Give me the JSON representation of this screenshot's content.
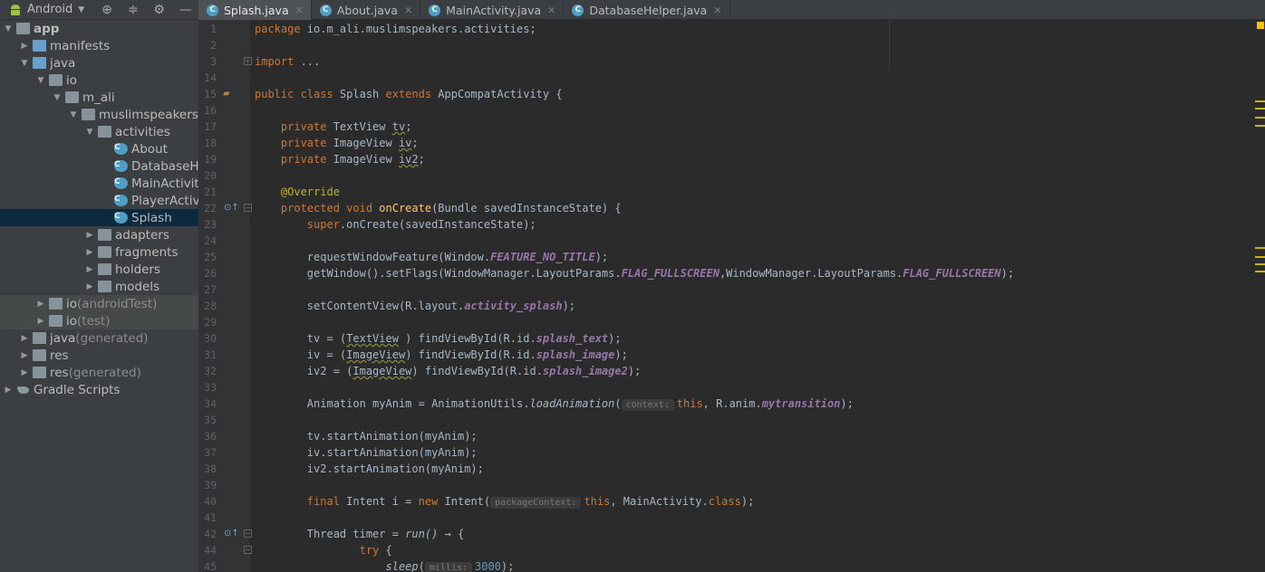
{
  "sidebar": {
    "view_mode": "Android",
    "toolbar_icons": [
      "target-icon",
      "collapse-icon",
      "gear-icon",
      "minimize-icon"
    ],
    "tree": [
      {
        "label": "app",
        "indent": 0,
        "arrow": "down",
        "icon": "module-folder-icon",
        "bold": true
      },
      {
        "label": "manifests",
        "indent": 1,
        "arrow": "right",
        "icon": "folder-icon"
      },
      {
        "label": "java",
        "indent": 1,
        "arrow": "down",
        "icon": "folder-icon"
      },
      {
        "label": "io",
        "indent": 2,
        "arrow": "down",
        "icon": "package-icon"
      },
      {
        "label": "m_ali",
        "indent": 3,
        "arrow": "down",
        "icon": "package-icon"
      },
      {
        "label": "muslimspeakers",
        "indent": 4,
        "arrow": "down",
        "icon": "package-icon"
      },
      {
        "label": "activities",
        "indent": 5,
        "arrow": "down",
        "icon": "package-icon"
      },
      {
        "label": "About",
        "indent": 6,
        "arrow": "",
        "icon": "class-icon"
      },
      {
        "label": "DatabaseHe",
        "indent": 6,
        "arrow": "",
        "icon": "class-icon"
      },
      {
        "label": "MainActivit",
        "indent": 6,
        "arrow": "",
        "icon": "class-icon"
      },
      {
        "label": "PlayerActivi",
        "indent": 6,
        "arrow": "",
        "icon": "class-icon"
      },
      {
        "label": "Splash",
        "indent": 6,
        "arrow": "",
        "icon": "class-icon",
        "selected": true
      },
      {
        "label": "adapters",
        "indent": 5,
        "arrow": "right",
        "icon": "package-icon"
      },
      {
        "label": "fragments",
        "indent": 5,
        "arrow": "right",
        "icon": "package-icon"
      },
      {
        "label": "holders",
        "indent": 5,
        "arrow": "right",
        "icon": "package-icon"
      },
      {
        "label": "models",
        "indent": 5,
        "arrow": "right",
        "icon": "package-icon"
      },
      {
        "label": "io",
        "sub": "(androidTest)",
        "indent": 2,
        "arrow": "right",
        "icon": "package-icon",
        "dim": true
      },
      {
        "label": "io",
        "sub": "(test)",
        "indent": 2,
        "arrow": "right",
        "icon": "package-icon",
        "dim": true
      },
      {
        "label": "java",
        "sub": "(generated)",
        "indent": 1,
        "arrow": "right",
        "icon": "generated-folder-icon"
      },
      {
        "label": "res",
        "indent": 1,
        "arrow": "right",
        "icon": "res-folder-icon"
      },
      {
        "label": "res",
        "sub": "(generated)",
        "indent": 1,
        "arrow": "right",
        "icon": "res-folder-icon"
      },
      {
        "label": "Gradle Scripts",
        "indent": 0,
        "arrow": "right",
        "icon": "gradle-icon"
      }
    ]
  },
  "tabs": [
    {
      "label": "Splash.java",
      "active": true
    },
    {
      "label": "About.java"
    },
    {
      "label": "MainActivity.java"
    },
    {
      "label": "DatabaseHelper.java"
    }
  ],
  "editor": {
    "lines": [
      {
        "n": "1",
        "tokens": [
          [
            "kw",
            "package "
          ],
          [
            "",
            "io.m_ali.muslimspeakers.activities;"
          ]
        ]
      },
      {
        "n": "2",
        "tokens": []
      },
      {
        "n": "3",
        "fold": "+",
        "tokens": [
          [
            "kw",
            "import "
          ],
          [
            "",
            "..."
          ]
        ]
      },
      {
        "n": "14",
        "tokens": []
      },
      {
        "n": "15",
        "gicon": "android-icon",
        "tokens": [
          [
            "kw",
            "public class "
          ],
          [
            "",
            "Splash "
          ],
          [
            "kw",
            "extends "
          ],
          [
            "",
            "AppCompatActivity {"
          ]
        ]
      },
      {
        "n": "16",
        "tokens": []
      },
      {
        "n": "17",
        "tokens": [
          [
            "",
            "    "
          ],
          [
            "kw",
            "private "
          ],
          [
            "",
            "TextView "
          ],
          [
            "ul",
            "tv"
          ],
          [
            "",
            ";"
          ]
        ]
      },
      {
        "n": "18",
        "tokens": [
          [
            "",
            "    "
          ],
          [
            "kw",
            "private "
          ],
          [
            "",
            "ImageView "
          ],
          [
            "ul",
            "iv"
          ],
          [
            "",
            ";"
          ]
        ]
      },
      {
        "n": "19",
        "tokens": [
          [
            "",
            "    "
          ],
          [
            "kw",
            "private "
          ],
          [
            "",
            "ImageView "
          ],
          [
            "ul",
            "iv2"
          ],
          [
            "",
            ";"
          ]
        ]
      },
      {
        "n": "20",
        "tokens": []
      },
      {
        "n": "21",
        "tokens": [
          [
            "",
            "    "
          ],
          [
            "an",
            "@Override"
          ]
        ]
      },
      {
        "n": "22",
        "gicon": "override-icon",
        "fold": "-",
        "tokens": [
          [
            "",
            "    "
          ],
          [
            "kw",
            "protected void "
          ],
          [
            "fn",
            "onCreate"
          ],
          [
            "",
            "(Bundle savedInstanceState) {"
          ]
        ]
      },
      {
        "n": "23",
        "tokens": [
          [
            "",
            "        "
          ],
          [
            "kw",
            "super"
          ],
          [
            "",
            ".onCreate(savedInstanceState);"
          ]
        ]
      },
      {
        "n": "24",
        "tokens": []
      },
      {
        "n": "25",
        "tokens": [
          [
            "",
            "        requestWindowFeature(Window."
          ],
          [
            "st",
            "FEATURE_NO_TITLE"
          ],
          [
            "",
            ");"
          ]
        ]
      },
      {
        "n": "26",
        "tokens": [
          [
            "",
            "        getWindow().setFlags(WindowManager.LayoutParams."
          ],
          [
            "st",
            "FLAG_FULLSCREEN"
          ],
          [
            "",
            ",WindowManager.LayoutParams."
          ],
          [
            "st",
            "FLAG_FULLSCREEN"
          ],
          [
            "",
            ");"
          ]
        ]
      },
      {
        "n": "27",
        "tokens": []
      },
      {
        "n": "28",
        "tokens": [
          [
            "",
            "        setContentView(R.layout."
          ],
          [
            "st",
            "activity_splash"
          ],
          [
            "",
            ");"
          ]
        ]
      },
      {
        "n": "29",
        "tokens": []
      },
      {
        "n": "30",
        "tokens": [
          [
            "",
            "        tv = ("
          ],
          [
            "ul",
            "TextView"
          ],
          [
            "",
            " ) findViewById(R.id."
          ],
          [
            "st",
            "splash_text"
          ],
          [
            "",
            ");"
          ]
        ]
      },
      {
        "n": "31",
        "tokens": [
          [
            "",
            "        iv = ("
          ],
          [
            "ul",
            "ImageView"
          ],
          [
            "",
            ") findViewById(R.id."
          ],
          [
            "st",
            "splash_image"
          ],
          [
            "",
            ");"
          ]
        ]
      },
      {
        "n": "32",
        "tokens": [
          [
            "",
            "        iv2 = ("
          ],
          [
            "ul",
            "ImageView"
          ],
          [
            "",
            ") findViewById(R.id."
          ],
          [
            "st",
            "splash_image2"
          ],
          [
            "",
            ");"
          ]
        ]
      },
      {
        "n": "33",
        "tokens": []
      },
      {
        "n": "34",
        "tokens": [
          [
            "",
            "        Animation myAnim = AnimationUtils."
          ],
          [
            "it",
            "loadAnimation"
          ],
          [
            "",
            "("
          ],
          [
            "hint",
            "context:"
          ],
          [
            "kw",
            "this"
          ],
          [
            "",
            ", R.anim."
          ],
          [
            "st",
            "mytransition"
          ],
          [
            "",
            ");"
          ]
        ]
      },
      {
        "n": "35",
        "tokens": []
      },
      {
        "n": "36",
        "tokens": [
          [
            "",
            "        tv.startAnimation(myAnim);"
          ]
        ]
      },
      {
        "n": "37",
        "tokens": [
          [
            "",
            "        iv.startAnimation(myAnim);"
          ]
        ]
      },
      {
        "n": "38",
        "tokens": [
          [
            "",
            "        iv2.startAnimation(myAnim);"
          ]
        ]
      },
      {
        "n": "39",
        "tokens": []
      },
      {
        "n": "40",
        "tokens": [
          [
            "",
            "        "
          ],
          [
            "kw",
            "final "
          ],
          [
            "",
            "Intent i = "
          ],
          [
            "kw",
            "new "
          ],
          [
            "",
            "Intent("
          ],
          [
            "hint",
            "packageContext:"
          ],
          [
            "kw",
            "this"
          ],
          [
            "",
            ", MainActivity."
          ],
          [
            "kw",
            "class"
          ],
          [
            "",
            ");"
          ]
        ]
      },
      {
        "n": "41",
        "tokens": []
      },
      {
        "n": "42",
        "gicon": "override-icon",
        "fold": "-",
        "tokens": [
          [
            "",
            "        Thread timer = "
          ],
          [
            "it",
            "run()"
          ],
          [
            "",
            " → {"
          ]
        ]
      },
      {
        "n": "44",
        "fold": "-",
        "tokens": [
          [
            "",
            "                "
          ],
          [
            "kw",
            "try "
          ],
          [
            "",
            "{"
          ]
        ]
      },
      {
        "n": "45",
        "tokens": [
          [
            "",
            "                    "
          ],
          [
            "it",
            "sleep"
          ],
          [
            "",
            "("
          ],
          [
            "hint",
            "millis:"
          ],
          [
            "nm",
            "3000"
          ],
          [
            "",
            ");"
          ]
        ]
      }
    ]
  }
}
